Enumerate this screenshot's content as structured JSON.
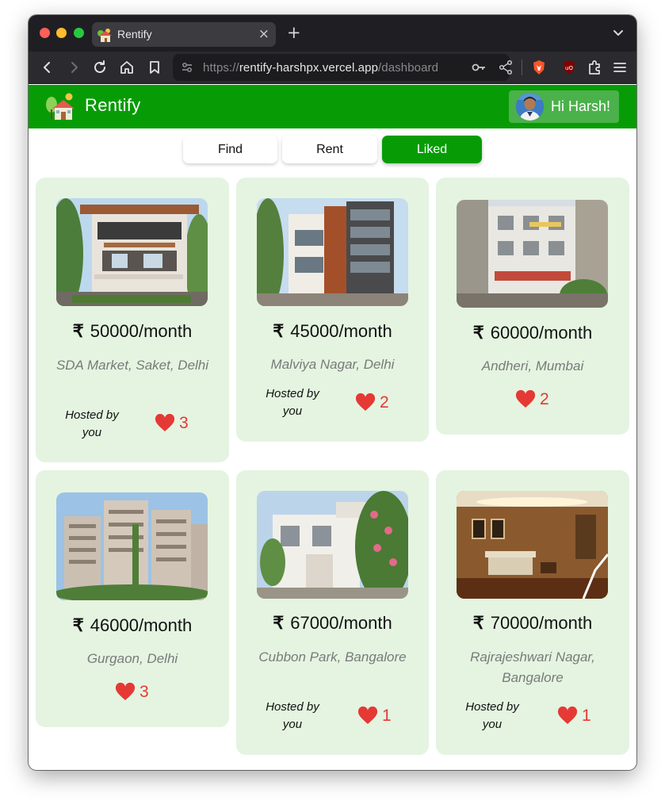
{
  "browser": {
    "tab_title": "Rentify",
    "tab_close": "×",
    "new_tab": "+",
    "url_scheme": "https://",
    "url_host": "rentify-harshpx.vercel.app",
    "url_path": "/dashboard"
  },
  "header": {
    "brand": "Rentify",
    "greeting": "Hi Harsh!",
    "color": "#079c06"
  },
  "tabs": [
    {
      "label": "Find",
      "active": false
    },
    {
      "label": "Rent",
      "active": false
    },
    {
      "label": "Liked",
      "active": true
    }
  ],
  "currency_symbol": "₹",
  "listings": [
    {
      "price": "50000/month",
      "location": "SDA Market, Saket, Delhi",
      "hosted": "Hosted by you",
      "likes": "3",
      "image": "modern-house-wood-facade"
    },
    {
      "price": "45000/month",
      "location": "Malviya Nagar, Delhi",
      "hosted": "Hosted by you",
      "likes": "2",
      "image": "apartment-building-wood-cladding"
    },
    {
      "price": "60000/month",
      "location": "Andheri, Mumbai",
      "hosted": "",
      "likes": "2",
      "image": "old-city-building"
    },
    {
      "price": "46000/month",
      "location": "Gurgaon, Delhi",
      "hosted": "",
      "likes": "3",
      "image": "apartment-tower-blocks"
    },
    {
      "price": "67000/month",
      "location": "Cubbon Park, Bangalore",
      "hosted": "Hosted by you",
      "likes": "1",
      "image": "white-villa-with-flowers"
    },
    {
      "price": "70000/month",
      "location": "Rajrajeshwari Nagar, Bangalore",
      "hosted": "Hosted by you",
      "likes": "1",
      "image": "living-room-interior"
    }
  ]
}
